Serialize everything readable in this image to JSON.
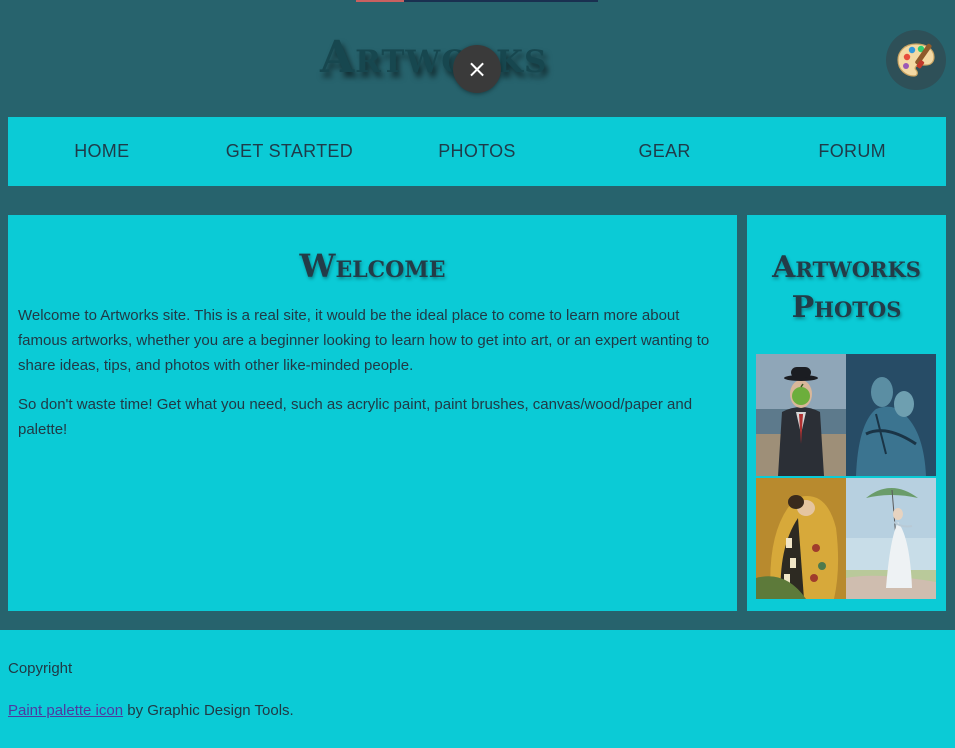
{
  "header": {
    "site_title": "Artworks",
    "close_label": "×"
  },
  "nav": {
    "items": [
      {
        "label": "HOME"
      },
      {
        "label": "GET STARTED"
      },
      {
        "label": "PHOTOS"
      },
      {
        "label": "GEAR"
      },
      {
        "label": "FORUM"
      }
    ]
  },
  "main": {
    "heading": "Welcome",
    "paragraphs": [
      "Welcome to Artworks site. This is a real site, it would be the ideal place to come to learn more about famous artworks, whether you are a beginner looking to learn how to get into art, or an expert wanting to share ideas, tips, and photos with other like-minded people.",
      "So don't waste time! Get what you need, such as acrylic paint, paint brushes, canvas/wood/paper and palette!"
    ]
  },
  "sidebar": {
    "heading_line1": "Artworks",
    "heading_line2": "Photos"
  },
  "footer": {
    "copyright": "Copyright",
    "credit_link": "Paint palette icon",
    "credit_text": " by Graphic Design Tools."
  },
  "colors": {
    "page_bg": "#27636d",
    "panel_bg": "#0bcbd6",
    "heading": "#233c48",
    "link": "#4e3aa0"
  }
}
